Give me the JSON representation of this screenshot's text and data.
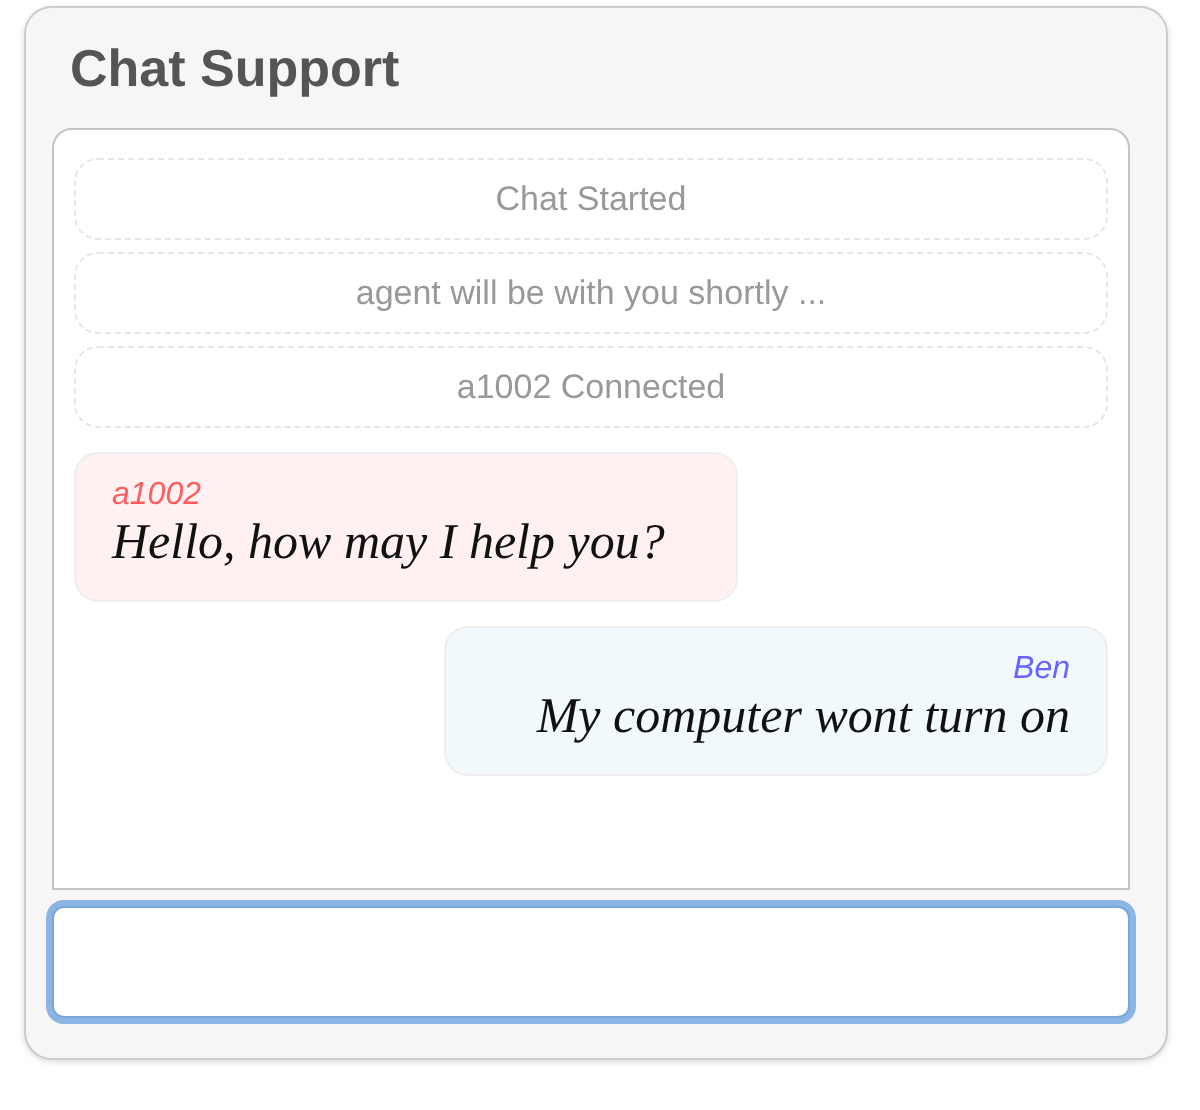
{
  "window": {
    "title": "Chat Support"
  },
  "notices": [
    "Chat Started",
    "agent will be with you shortly ...",
    "a1002 Connected"
  ],
  "messages": [
    {
      "kind": "agent",
      "sender": "a1002",
      "color": "#ff5c5c",
      "text": "Hello, how may I help you?"
    },
    {
      "kind": "user",
      "sender": "Ben",
      "color": "#6a64ff",
      "text": "My computer wont turn on"
    }
  ],
  "input": {
    "focused": true
  }
}
